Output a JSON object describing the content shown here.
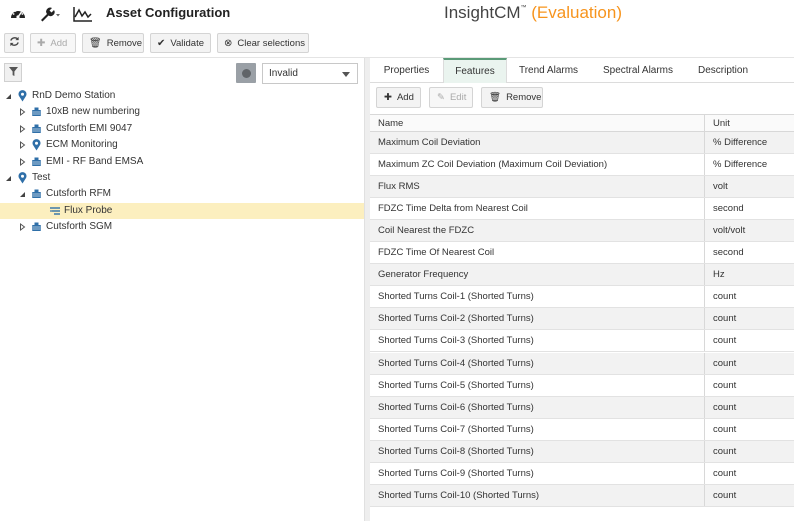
{
  "header": {
    "title": "Asset Configuration",
    "brand": "InsightCM",
    "brand_tm": "™",
    "brand_edition": "(Evaluation)",
    "accent_color": "#f7941d"
  },
  "toolbar": {
    "refresh_icon": "refresh-icon",
    "add_label": "Add",
    "remove_label": "Remove",
    "validate_label": "Validate",
    "clear_label": "Clear selections"
  },
  "filter": {
    "status_value": "Invalid"
  },
  "tree": [
    {
      "label": "RnD Demo Station",
      "icon": "location-pin-icon",
      "toggle": "expanded",
      "level": 0
    },
    {
      "label": "10xB new numbering",
      "icon": "machine-icon",
      "toggle": "collapsed",
      "level": 1
    },
    {
      "label": "Cutsforth EMI 9047",
      "icon": "machine-icon",
      "toggle": "collapsed",
      "level": 1
    },
    {
      "label": "ECM Monitoring",
      "icon": "location-pin-icon",
      "toggle": "collapsed",
      "level": 1
    },
    {
      "label": "EMI - RF Band EMSA",
      "icon": "machine-icon",
      "toggle": "collapsed",
      "level": 1
    },
    {
      "label": "Test",
      "icon": "location-pin-icon",
      "toggle": "expanded",
      "level": 0
    },
    {
      "label": "Cutsforth RFM",
      "icon": "machine-icon",
      "toggle": "expanded",
      "level": 1
    },
    {
      "label": "Flux Probe",
      "icon": "sensor-icon",
      "toggle": "none",
      "level": 2,
      "selected": true
    },
    {
      "label": "Cutsforth SGM",
      "icon": "machine-icon",
      "toggle": "collapsed",
      "level": 1
    }
  ],
  "tabs": [
    {
      "label": "Properties",
      "active": false
    },
    {
      "label": "Features",
      "active": true
    },
    {
      "label": "Trend Alarms",
      "active": false
    },
    {
      "label": "Spectral Alarms",
      "active": false
    },
    {
      "label": "Description",
      "active": false
    }
  ],
  "features_toolbar": {
    "add_label": "Add",
    "edit_label": "Edit",
    "remove_label": "Remove"
  },
  "table": {
    "columns": [
      "Name",
      "Unit"
    ],
    "rows": [
      {
        "name": "Maximum Coil Deviation",
        "unit": "% Difference"
      },
      {
        "name": "Maximum ZC Coil Deviation (Maximum Coil Deviation)",
        "unit": "% Difference"
      },
      {
        "name": "Flux RMS",
        "unit": "volt"
      },
      {
        "name": "FDZC Time Delta from Nearest Coil",
        "unit": "second"
      },
      {
        "name": "Coil Nearest the FDZC",
        "unit": "volt/volt"
      },
      {
        "name": "FDZC Time Of Nearest Coil",
        "unit": "second"
      },
      {
        "name": "Generator Frequency",
        "unit": "Hz"
      },
      {
        "name": "Shorted Turns Coil-1 (Shorted Turns)",
        "unit": "count"
      },
      {
        "name": "Shorted Turns Coil-2 (Shorted Turns)",
        "unit": "count"
      },
      {
        "name": "Shorted Turns Coil-3 (Shorted Turns)",
        "unit": "count"
      },
      {
        "name": "Shorted Turns Coil-4 (Shorted Turns)",
        "unit": "count"
      },
      {
        "name": "Shorted Turns Coil-5 (Shorted Turns)",
        "unit": "count"
      },
      {
        "name": "Shorted Turns Coil-6 (Shorted Turns)",
        "unit": "count"
      },
      {
        "name": "Shorted Turns Coil-7 (Shorted Turns)",
        "unit": "count"
      },
      {
        "name": "Shorted Turns Coil-8 (Shorted Turns)",
        "unit": "count"
      },
      {
        "name": "Shorted Turns Coil-9 (Shorted Turns)",
        "unit": "count"
      },
      {
        "name": "Shorted Turns Coil-10 (Shorted Turns)",
        "unit": "count"
      }
    ]
  }
}
